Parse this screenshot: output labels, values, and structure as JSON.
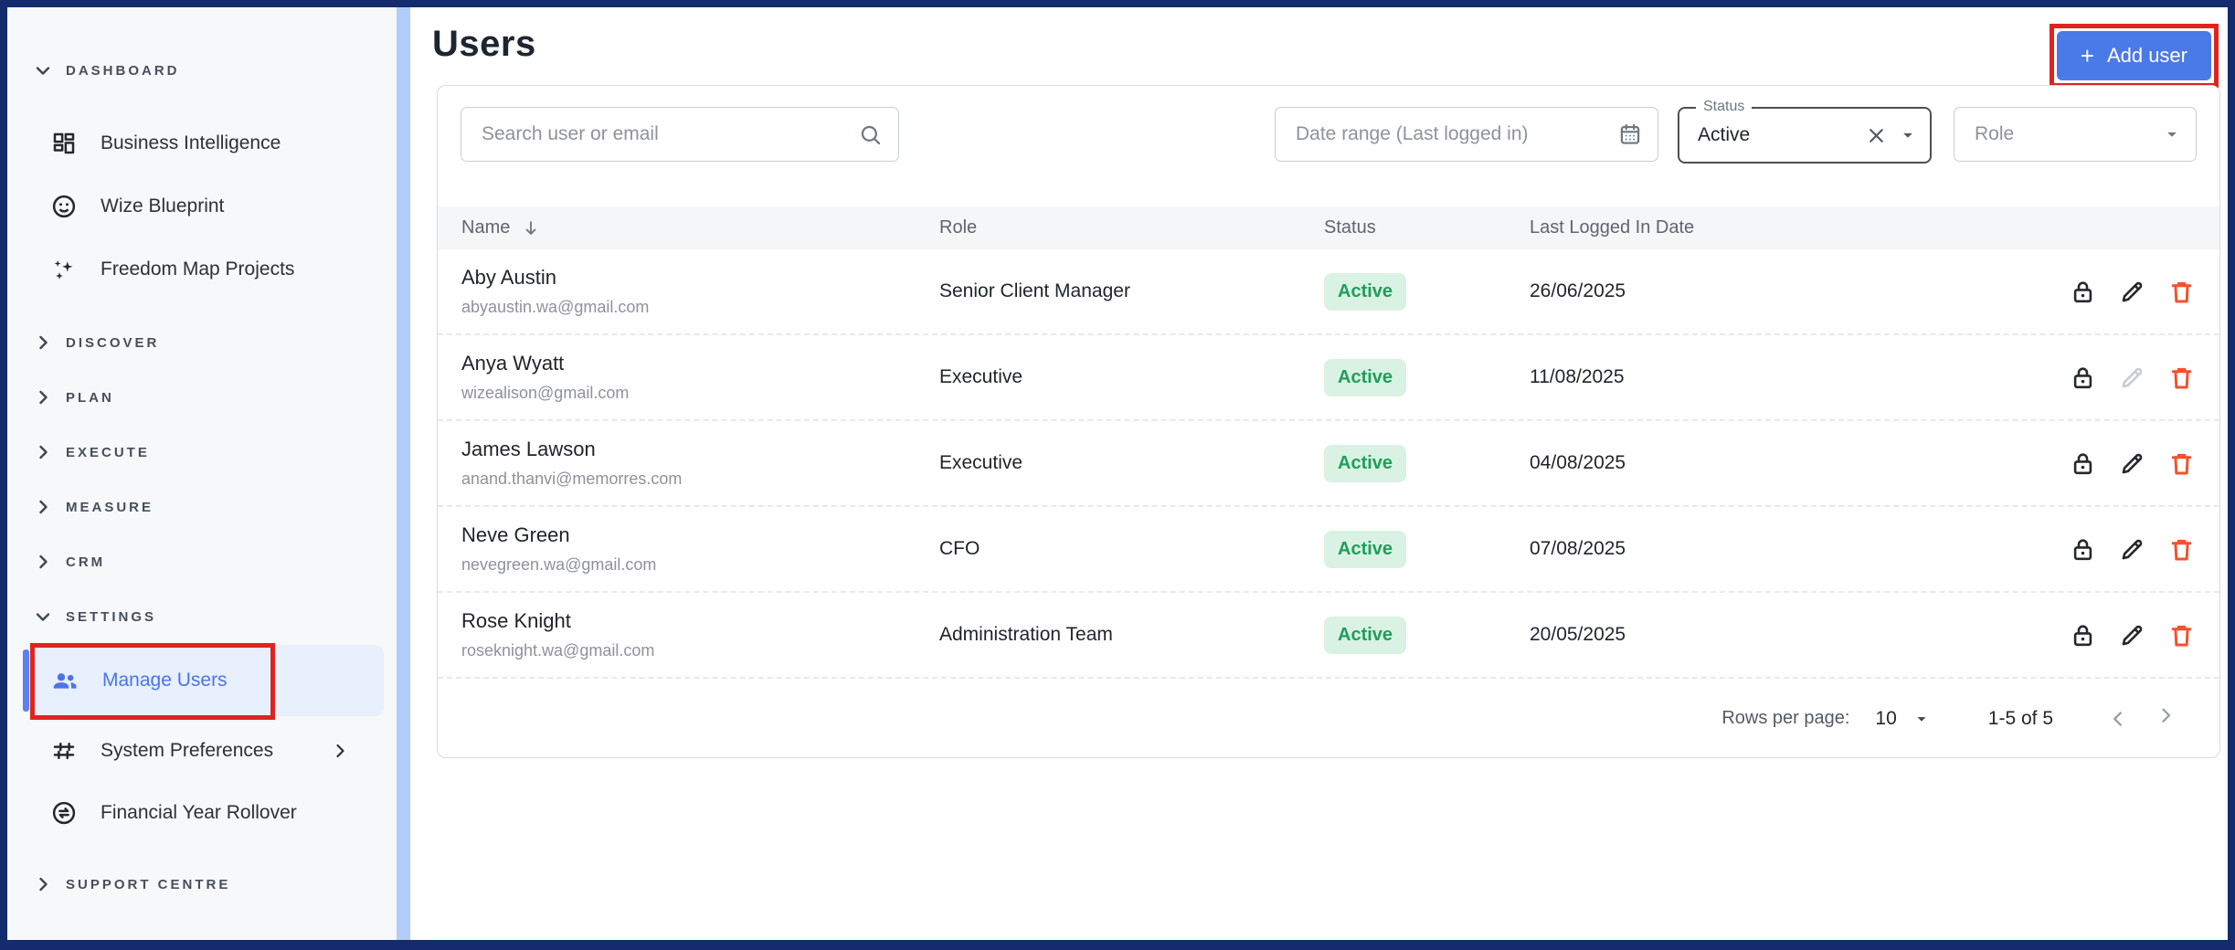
{
  "colors": {
    "frame_navy": "#142b6e",
    "accent_blue": "#4a79e8",
    "sidebar_selected_bg": "#e8effd",
    "sidebar_strip_blue": "#b3cdfa",
    "badge_bg": "#d9f2e3",
    "badge_text": "#1f9e5a",
    "delete_red": "#f4512e",
    "annotation_red": "#df2420"
  },
  "sidebar": {
    "dashboard": {
      "label": "DASHBOARD",
      "items": [
        {
          "label": "Business Intelligence",
          "icon": "grid-icon"
        },
        {
          "label": "Wize Blueprint",
          "icon": "face-icon"
        },
        {
          "label": "Freedom Map Projects",
          "icon": "sparkles-icon"
        }
      ]
    },
    "collapsed": [
      {
        "label": "DISCOVER"
      },
      {
        "label": "PLAN"
      },
      {
        "label": "EXECUTE"
      },
      {
        "label": "MEASURE"
      },
      {
        "label": "CRM"
      }
    ],
    "settings": {
      "label": "SETTINGS",
      "items": [
        {
          "label": "Manage Users",
          "icon": "people-icon",
          "selected": true
        },
        {
          "label": "System Preferences",
          "icon": "sliders-icon",
          "has_submenu": true
        },
        {
          "label": "Financial Year Rollover",
          "icon": "rollover-icon"
        }
      ]
    },
    "support": {
      "label": "SUPPORT CENTRE"
    }
  },
  "header": {
    "title": "Users",
    "add_user_plus": "+",
    "add_user_label": "Add user"
  },
  "filters": {
    "search_placeholder": "Search user or email",
    "date_placeholder": "Date range (Last logged in)",
    "status_label": "Status",
    "status_value": "Active",
    "role_label": "Role"
  },
  "table": {
    "columns": {
      "name": "Name",
      "role": "Role",
      "status": "Status",
      "last_logged": "Last Logged In Date"
    },
    "rows": [
      {
        "name": "Aby Austin",
        "email": "abyaustin.wa@gmail.com",
        "role": "Senior Client Manager",
        "status": "Active",
        "last_logged": "26/06/2025"
      },
      {
        "name": "Anya Wyatt",
        "email": "wizealison@gmail.com",
        "role": "Executive",
        "status": "Active",
        "last_logged": "11/08/2025",
        "edit_disabled": true
      },
      {
        "name": "James Lawson",
        "email": "anand.thanvi@memorres.com",
        "role": "Executive",
        "status": "Active",
        "last_logged": "04/08/2025"
      },
      {
        "name": "Neve Green",
        "email": "nevegreen.wa@gmail.com",
        "role": "CFO",
        "status": "Active",
        "last_logged": "07/08/2025"
      },
      {
        "name": "Rose Knight",
        "email": "roseknight.wa@gmail.com",
        "role": "Administration Team",
        "status": "Active",
        "last_logged": "20/05/2025"
      }
    ]
  },
  "pagination": {
    "rows_per_page_label": "Rows per page:",
    "rows_per_page_value": "10",
    "range": "1-5 of 5"
  }
}
